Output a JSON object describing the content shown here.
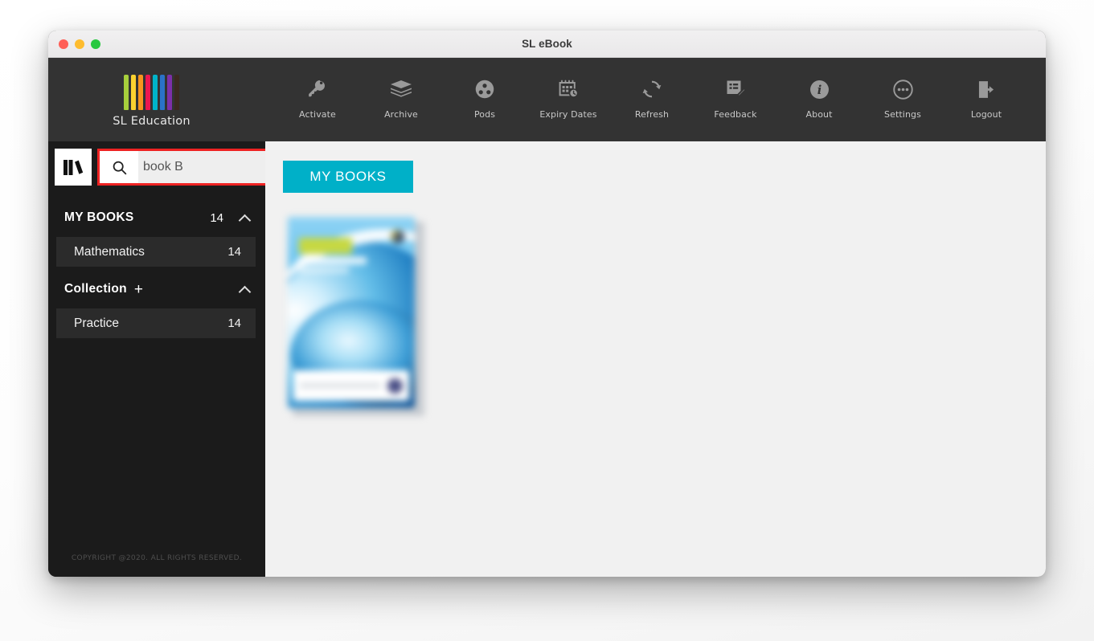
{
  "window": {
    "title": "SL eBook",
    "controls": [
      "close",
      "minimize",
      "maximize"
    ]
  },
  "brand": {
    "name": "SL Education",
    "bar_colors": [
      "#a7cf3c",
      "#fbd230",
      "#f7941e",
      "#ec1651",
      "#00b3c9",
      "#2a72c8",
      "#7d2fa8",
      "#3b2a20"
    ]
  },
  "toolbar": {
    "items": [
      {
        "label": "Activate",
        "icon": "key-icon"
      },
      {
        "label": "Archive",
        "icon": "books-stack-icon"
      },
      {
        "label": "Pods",
        "icon": "film-reel-icon"
      },
      {
        "label": "Expiry Dates",
        "icon": "calendar-clock-icon"
      },
      {
        "label": "Refresh",
        "icon": "refresh-icon"
      },
      {
        "label": "Feedback",
        "icon": "note-pencil-icon"
      },
      {
        "label": "About",
        "icon": "info-circle-icon"
      },
      {
        "label": "Settings",
        "icon": "ellipsis-circle-icon"
      },
      {
        "label": "Logout",
        "icon": "logout-icon"
      }
    ]
  },
  "sidebar": {
    "logo_icon": "books-logo-icon",
    "search": {
      "value": "book B",
      "placeholder": "Search",
      "icon": "search-icon",
      "highlight_color": "#ee2222"
    },
    "sections": [
      {
        "title": "MY BOOKS",
        "count": "14",
        "expanded": true,
        "has_add": false,
        "items": [
          {
            "label": "Mathematics",
            "count": "14"
          }
        ]
      },
      {
        "title": "Collection",
        "count": "",
        "expanded": true,
        "has_add": true,
        "add_label": "+",
        "items": [
          {
            "label": "Practice",
            "count": "14"
          }
        ]
      }
    ],
    "copyright": "COPYRIGHT @2020. ALL RIGHTS RESERVED."
  },
  "main": {
    "tab_label": "MY BOOKS",
    "accent_color": "#00b0c8",
    "books": [
      {
        "name": "book-cover-thumbnail"
      }
    ]
  }
}
